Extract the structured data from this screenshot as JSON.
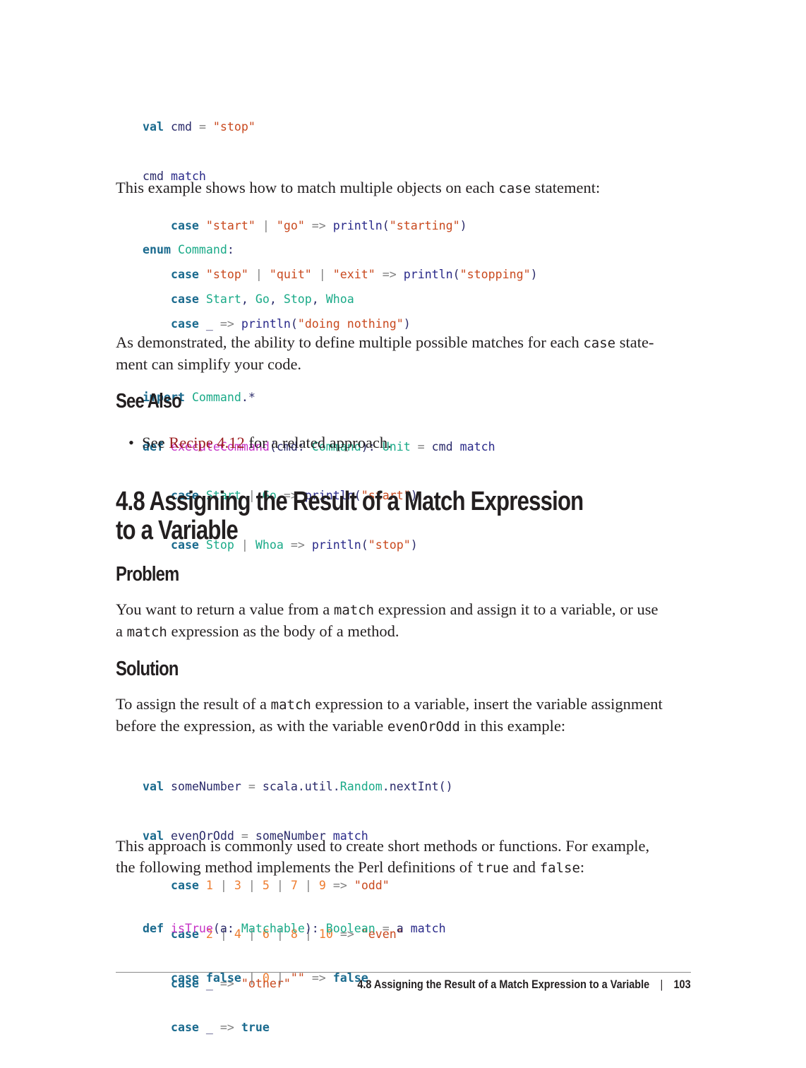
{
  "code1": {
    "l1": [
      [
        "kw",
        "val"
      ],
      [
        "id",
        " cmd "
      ],
      [
        "op",
        "="
      ],
      [
        "str",
        " \"stop\""
      ]
    ],
    "l2": [
      [
        "id",
        "cmd "
      ],
      [
        "mt",
        "match"
      ]
    ],
    "l3": [
      [
        "kw",
        "    case "
      ],
      [
        "str",
        "\"start\""
      ],
      [
        "op",
        " | "
      ],
      [
        "str",
        "\"go\""
      ],
      [
        "op",
        " => "
      ],
      [
        "mt",
        "println"
      ],
      [
        "id",
        "("
      ],
      [
        "str",
        "\"starting\""
      ],
      [
        "id",
        ")"
      ]
    ],
    "l4": [
      [
        "kw",
        "    case "
      ],
      [
        "str",
        "\"stop\""
      ],
      [
        "op",
        " | "
      ],
      [
        "str",
        "\"quit\""
      ],
      [
        "op",
        " | "
      ],
      [
        "str",
        "\"exit\""
      ],
      [
        "op",
        " => "
      ],
      [
        "mt",
        "println"
      ],
      [
        "id",
        "("
      ],
      [
        "str",
        "\"stopping\""
      ],
      [
        "id",
        ")"
      ]
    ],
    "l5": [
      [
        "kw",
        "    case "
      ],
      [
        "id",
        "_"
      ],
      [
        "op",
        " => "
      ],
      [
        "mt",
        "println"
      ],
      [
        "id",
        "("
      ],
      [
        "str",
        "\"doing nothing\""
      ],
      [
        "id",
        ")"
      ]
    ]
  },
  "para1": {
    "before": "This example shows how to match multiple objects on each ",
    "code": "case",
    "after": " statement:"
  },
  "code2": {
    "l1": [
      [
        "kw",
        "enum "
      ],
      [
        "ty",
        "Command"
      ],
      [
        "id",
        ":"
      ]
    ],
    "l2": [
      [
        "kw",
        "    case "
      ],
      [
        "ty",
        "Start"
      ],
      [
        "id",
        ", "
      ],
      [
        "ty",
        "Go"
      ],
      [
        "id",
        ", "
      ],
      [
        "ty",
        "Stop"
      ],
      [
        "id",
        ", "
      ],
      [
        "ty",
        "Whoa"
      ]
    ],
    "l3": [],
    "l4": [
      [
        "kw",
        "import "
      ],
      [
        "ty",
        "Command"
      ],
      [
        "id",
        ".*"
      ]
    ],
    "l5": [
      [
        "kw",
        "def "
      ],
      [
        "fn",
        "executeCommand"
      ],
      [
        "id",
        "(cmd: "
      ],
      [
        "ty",
        "Command"
      ],
      [
        "id",
        "): "
      ],
      [
        "ty",
        "Unit"
      ],
      [
        "op",
        " = "
      ],
      [
        "id",
        "cmd "
      ],
      [
        "mt",
        "match"
      ]
    ],
    "l6": [
      [
        "kw",
        "    case "
      ],
      [
        "ty",
        "Start"
      ],
      [
        "op",
        " | "
      ],
      [
        "ty",
        "Go"
      ],
      [
        "op",
        " => "
      ],
      [
        "mt",
        "println"
      ],
      [
        "id",
        "("
      ],
      [
        "str",
        "\"start\""
      ],
      [
        "id",
        ")"
      ]
    ],
    "l7": [
      [
        "kw",
        "    case "
      ],
      [
        "ty",
        "Stop"
      ],
      [
        "op",
        " | "
      ],
      [
        "ty",
        "Whoa"
      ],
      [
        "op",
        " => "
      ],
      [
        "mt",
        "println"
      ],
      [
        "id",
        "("
      ],
      [
        "str",
        "\"stop\""
      ],
      [
        "id",
        ")"
      ]
    ]
  },
  "para2": {
    "before": "As demonstrated, the ability to define multiple possible matches for each ",
    "code": "case",
    "after": " state-",
    "line2": "ment can simplify your code."
  },
  "see_also": {
    "heading": "See Also",
    "bullet_prefix": "See ",
    "link": "Recipe 4.12",
    "bullet_suffix": " for a related approach."
  },
  "section": {
    "title_line1": "4.8 Assigning the Result of a Match Expression",
    "title_line2": "to a Variable"
  },
  "problem": {
    "heading": "Problem",
    "p1_before": "You want to return a value from a ",
    "p1_code": "match",
    "p1_after": " expression and assign it to a variable, or use",
    "p2_before": "a ",
    "p2_code": "match",
    "p2_after": " expression as the body of a method."
  },
  "solution": {
    "heading": "Solution",
    "p1_before": "To assign the result of a ",
    "p1_code": "match",
    "p1_after": " expression to a variable, insert the variable assignment",
    "p2_before": "before the expression, as with the variable ",
    "p2_code": "evenOrOdd",
    "p2_after": " in this example:"
  },
  "code3": {
    "l1": [
      [
        "kw",
        "val "
      ],
      [
        "id",
        "someNumber "
      ],
      [
        "op",
        "="
      ],
      [
        "id",
        " scala.util."
      ],
      [
        "ty",
        "Random"
      ],
      [
        "id",
        ".nextInt()"
      ]
    ],
    "l2": [
      [
        "kw",
        "val "
      ],
      [
        "id",
        "evenOrOdd "
      ],
      [
        "op",
        "="
      ],
      [
        "id",
        " someNumber "
      ],
      [
        "mt",
        "match"
      ]
    ],
    "l3": [
      [
        "kw",
        "    case "
      ],
      [
        "num",
        "1"
      ],
      [
        "op",
        " | "
      ],
      [
        "num",
        "3"
      ],
      [
        "op",
        " | "
      ],
      [
        "num",
        "5"
      ],
      [
        "op",
        " | "
      ],
      [
        "num",
        "7"
      ],
      [
        "op",
        " | "
      ],
      [
        "num",
        "9"
      ],
      [
        "op",
        " => "
      ],
      [
        "str",
        "\"odd\""
      ]
    ],
    "l4": [
      [
        "kw",
        "    case "
      ],
      [
        "num",
        "2"
      ],
      [
        "op",
        " | "
      ],
      [
        "num",
        "4"
      ],
      [
        "op",
        " | "
      ],
      [
        "num",
        "6"
      ],
      [
        "op",
        " | "
      ],
      [
        "num",
        "8"
      ],
      [
        "op",
        " | "
      ],
      [
        "num",
        "10"
      ],
      [
        "op",
        " => "
      ],
      [
        "str",
        "\"even\""
      ]
    ],
    "l5": [
      [
        "kw",
        "    case "
      ],
      [
        "id",
        "_"
      ],
      [
        "op",
        " => "
      ],
      [
        "str",
        "\"other\""
      ]
    ]
  },
  "para3": {
    "l1": "This approach is commonly used to create short methods or functions. For example,",
    "l2_before": "the following method implements the Perl definitions of ",
    "l2_code1": "true",
    "l2_mid": " and ",
    "l2_code2": "false",
    "l2_after": ":"
  },
  "code4": {
    "l1": [
      [
        "kw",
        "def "
      ],
      [
        "fn",
        "isTrue"
      ],
      [
        "id",
        "(a: "
      ],
      [
        "ty",
        "Matchable"
      ],
      [
        "id",
        "): "
      ],
      [
        "ty",
        "Boolean"
      ],
      [
        "op",
        " = "
      ],
      [
        "id",
        "a "
      ],
      [
        "mt",
        "match"
      ]
    ],
    "l2": [
      [
        "kw",
        "    case false"
      ],
      [
        "op",
        " | "
      ],
      [
        "num",
        "0"
      ],
      [
        "op",
        " | "
      ],
      [
        "str",
        "\"\""
      ],
      [
        "op",
        " => "
      ],
      [
        "kw",
        "false"
      ]
    ],
    "l3": [
      [
        "kw",
        "    case "
      ],
      [
        "id",
        "_"
      ],
      [
        "op",
        " => "
      ],
      [
        "kw",
        "true"
      ]
    ]
  },
  "footer": {
    "running_title": "4.8 Assigning the Result of a Match Expression to a Variable",
    "separator": "|",
    "page_number": "103"
  }
}
